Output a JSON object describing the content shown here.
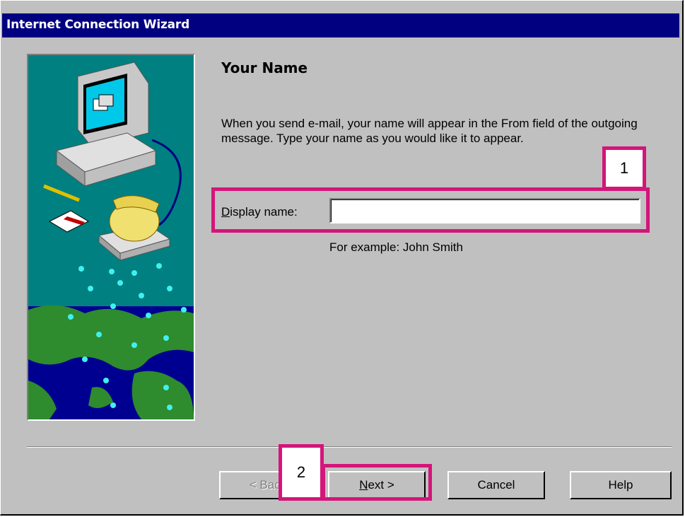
{
  "window": {
    "title": "Internet Connection Wizard"
  },
  "page": {
    "heading": "Your Name",
    "description": "When you send e-mail, your name will appear in the From field of the outgoing message.  Type your name as you would like it to appear.",
    "display_name": {
      "label_accel": "D",
      "label_rest": "isplay name:",
      "value": ""
    },
    "example": "For example: John Smith"
  },
  "buttons": {
    "back": {
      "label": "< Back",
      "enabled": false
    },
    "next": {
      "accel": "N",
      "rest": "ext >"
    },
    "cancel": "Cancel",
    "help": "Help"
  },
  "callouts": [
    {
      "label": "1"
    },
    {
      "label": "2"
    }
  ],
  "colors": {
    "titlebar": "#000080",
    "callout": "#d4157a",
    "art_background": "#008080"
  }
}
